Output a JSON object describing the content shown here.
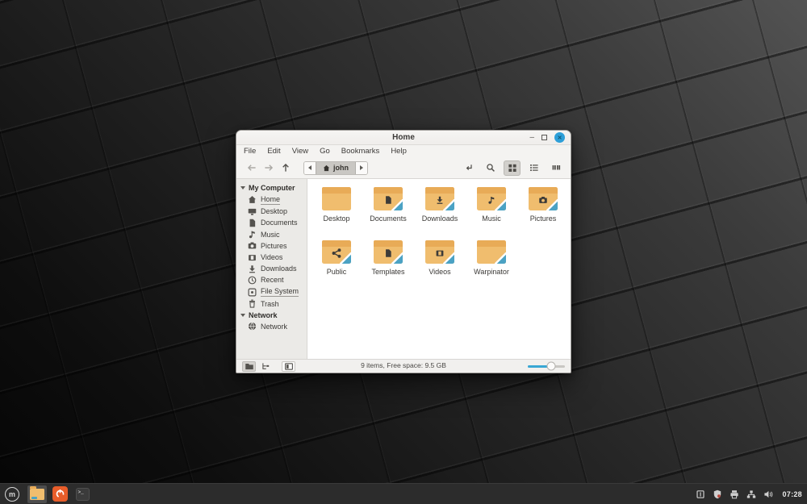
{
  "window": {
    "title": "Home",
    "controls": {
      "minimize": "–",
      "close": "✕"
    },
    "menu_items": [
      "File",
      "Edit",
      "View",
      "Go",
      "Bookmarks",
      "Help"
    ],
    "toolbar": {
      "nav_buttons": [
        {
          "name": "back-button",
          "icon": "arrow-left",
          "enabled": false
        },
        {
          "name": "forward-button",
          "icon": "arrow-right",
          "enabled": false
        },
        {
          "name": "up-button",
          "icon": "arrow-up",
          "enabled": true
        }
      ],
      "path": {
        "segment": "john",
        "segment_icon": "home"
      },
      "right_buttons": [
        {
          "name": "toggle-location-entry-button",
          "icon": "location-entry",
          "active": false
        },
        {
          "name": "search-button",
          "icon": "search",
          "active": false
        },
        {
          "name": "grid-view-button",
          "icon": "grid",
          "active": true
        },
        {
          "name": "list-view-button",
          "icon": "list",
          "active": false
        },
        {
          "name": "compact-view-button",
          "icon": "compact",
          "active": false
        }
      ]
    },
    "sidebar": {
      "sections": [
        {
          "label": "My Computer",
          "items": [
            {
              "label": "Home",
              "icon": "home",
              "underline": true
            },
            {
              "label": "Desktop",
              "icon": "desktop",
              "underline": false
            },
            {
              "label": "Documents",
              "icon": "document",
              "underline": false
            },
            {
              "label": "Music",
              "icon": "music",
              "underline": false
            },
            {
              "label": "Pictures",
              "icon": "camera",
              "underline": false
            },
            {
              "label": "Videos",
              "icon": "video",
              "underline": false
            },
            {
              "label": "Downloads",
              "icon": "download",
              "underline": false
            },
            {
              "label": "Recent",
              "icon": "clock",
              "underline": false
            },
            {
              "label": "File System",
              "icon": "disk",
              "underline": true
            },
            {
              "label": "Trash",
              "icon": "trash",
              "underline": false
            }
          ]
        },
        {
          "label": "Network",
          "items": [
            {
              "label": "Network",
              "icon": "globe",
              "underline": false
            }
          ]
        }
      ]
    },
    "files": [
      {
        "label": "Desktop",
        "emblem": null,
        "corner": false
      },
      {
        "label": "Documents",
        "emblem": "document",
        "corner": true
      },
      {
        "label": "Downloads",
        "emblem": "download",
        "corner": true
      },
      {
        "label": "Music",
        "emblem": "music",
        "corner": true
      },
      {
        "label": "Pictures",
        "emblem": "camera",
        "corner": true
      },
      {
        "label": "Public",
        "emblem": "share",
        "corner": true
      },
      {
        "label": "Templates",
        "emblem": "document",
        "corner": true
      },
      {
        "label": "Videos",
        "emblem": "video",
        "corner": true
      },
      {
        "label": "Warpinator",
        "emblem": null,
        "corner": true
      }
    ],
    "statusbar": {
      "toggles": [
        {
          "name": "places-toggle-button",
          "icon": "folder-mini",
          "active": true,
          "sep": false
        },
        {
          "name": "treeview-toggle-button",
          "icon": "tree",
          "active": false,
          "sep": false
        },
        {
          "name": "sidebar-toggle-button",
          "icon": "pane-toggle",
          "active": false,
          "sep": true
        }
      ],
      "text": "9 items, Free space: 9.5 GB",
      "zoom_percent": 62
    }
  },
  "taskbar": {
    "menu_glyph": "m",
    "terminal_glyph": ">_",
    "tray_icons": [
      "xapp-status",
      "shield-update",
      "printer",
      "network-tray",
      "volume"
    ],
    "clock": "07:28"
  },
  "colors": {
    "accent_close": "#2d9fd8",
    "folder_body": "#f0bd6e",
    "folder_flap": "#e8ab57",
    "corner_teal": "#4ba2c4",
    "slider_fill": "#39a7d4",
    "orange_app": "#e85d2a"
  }
}
